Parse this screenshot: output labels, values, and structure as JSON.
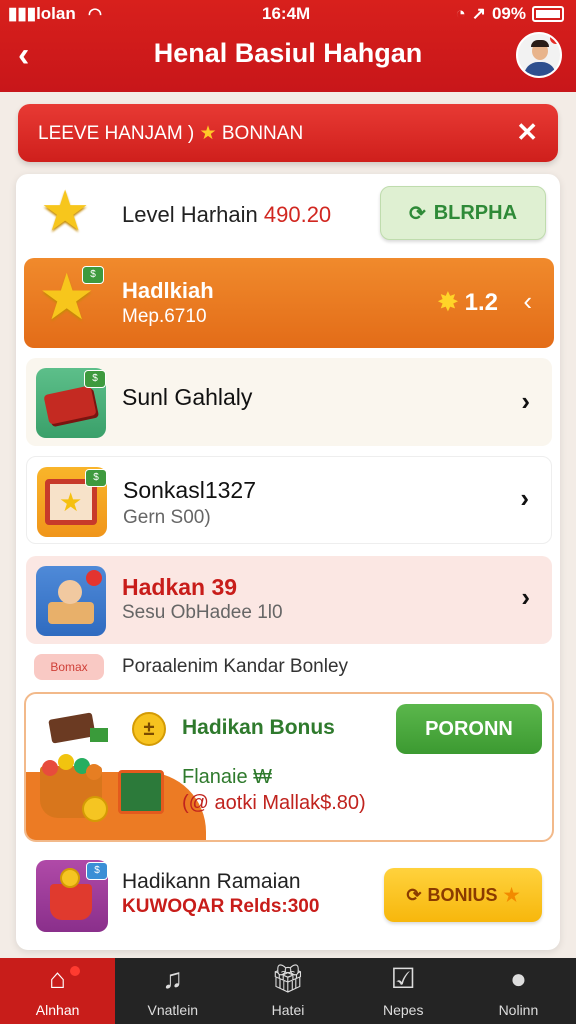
{
  "status_bar": {
    "carrier": "lolan",
    "time": "16:4M",
    "battery": "09%"
  },
  "header": {
    "title": "Henal Basiul Hahgan",
    "back": "‹"
  },
  "banner": {
    "text_prefix": "LEEVE HANJAM )",
    "star": "★",
    "text_suffix": "BONNAN",
    "close": "✕"
  },
  "level_row": {
    "label": "Level Harhain",
    "value": "490.20",
    "button": "BLRPHA",
    "button_icon": "⟳"
  },
  "featured_row": {
    "title": "Hadlkiah",
    "subtitle": "Mep.6710",
    "amount": "1.2",
    "chevron": "‹"
  },
  "rows": [
    {
      "title": "Sunl Gahlaly",
      "subtitle": ""
    },
    {
      "title": "Sonkasl1327",
      "subtitle": "Gern S00)"
    },
    {
      "title": "Hadkan 39",
      "subtitle": "Sesu ObHadee 1l0"
    }
  ],
  "tag_row": {
    "pill": "Bomax",
    "text": "Poraalenim Kandar Bonley"
  },
  "bonus_card": {
    "plus": "±",
    "title": "Hadikan Bonus",
    "button": "PORONN",
    "line1": "Flanaie  ₩",
    "line2": "(@ aotki Mallak$.80)"
  },
  "last_row": {
    "title_bold": "Hadikann",
    "title_rest": " Ramaian",
    "subtitle": "KUWOQAR Relds:300",
    "button": "BONIUS",
    "button_icon": "⟳",
    "button_star": "★"
  },
  "nav": [
    {
      "label": "Alnhan",
      "icon": "home-icon"
    },
    {
      "label": "Vnatlein",
      "icon": "music-icon"
    },
    {
      "label": "Hatei",
      "icon": "gift-icon"
    },
    {
      "label": "Nepes",
      "icon": "tasks-icon"
    },
    {
      "label": "Nolinn",
      "icon": "profile-icon"
    }
  ],
  "colors": {
    "primary_red": "#c8161a",
    "orange": "#e36c18",
    "green": "#3c9a31",
    "yellow": "#f7b70c",
    "nav_bg": "#242424"
  }
}
